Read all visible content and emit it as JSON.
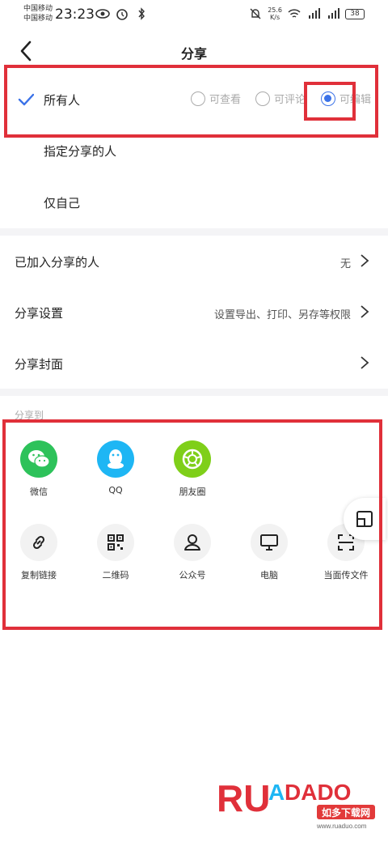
{
  "status_bar": {
    "carrier_1": "中国移动",
    "carrier_2": "中国移动",
    "time": "23:23",
    "net_speed_value": "25.6",
    "net_speed_unit": "K/s",
    "battery": "38"
  },
  "header": {
    "title": "分享"
  },
  "audience": {
    "everyone_label": "所有人",
    "permissions": [
      {
        "label": "可查看",
        "selected": false
      },
      {
        "label": "可评论",
        "selected": false
      },
      {
        "label": "可编辑",
        "selected": true
      }
    ],
    "specific_label": "指定分享的人",
    "only_me_label": "仅自己"
  },
  "settings": {
    "joined": {
      "label": "已加入分享的人",
      "value": "无"
    },
    "share_settings": {
      "label": "分享设置",
      "value": "设置导出、打印、另存等权限"
    },
    "cover": {
      "label": "分享封面"
    }
  },
  "share_to": {
    "heading": "分享到",
    "row1": [
      {
        "label": "微信",
        "icon": "wechat-icon",
        "color": "#2dc25a"
      },
      {
        "label": "QQ",
        "icon": "qq-icon",
        "color": "#1eb6f4"
      },
      {
        "label": "朋友圈",
        "icon": "moments-icon",
        "color": "#7fcf19"
      }
    ],
    "row2": [
      {
        "label": "复制链接",
        "icon": "link-icon"
      },
      {
        "label": "二维码",
        "icon": "qrcode-icon"
      },
      {
        "label": "公众号",
        "icon": "official-account-icon"
      },
      {
        "label": "电脑",
        "icon": "monitor-icon"
      },
      {
        "label": "当面传文件",
        "icon": "scan-icon"
      }
    ]
  },
  "watermark": {
    "text": "RUANDADO",
    "cn": "如多下载网",
    "url": "www.ruaduo.com"
  },
  "colors": {
    "accent": "#3b72e8",
    "annotation": "#e0303a"
  }
}
